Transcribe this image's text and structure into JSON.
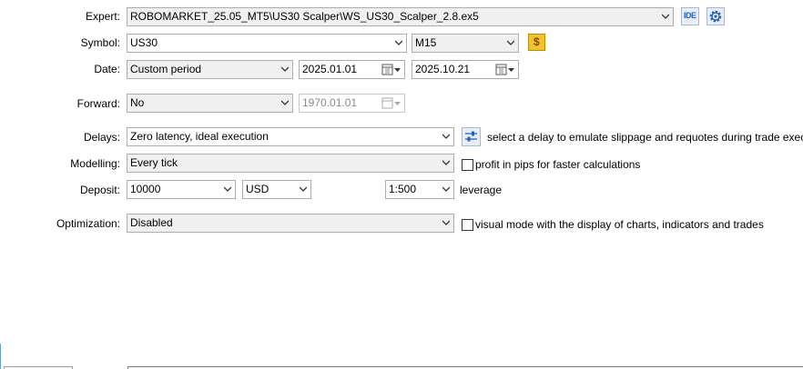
{
  "expert": {
    "label": "Expert:",
    "value": "ROBOMARKET_25.05_MT5\\US30 Scalper\\WS_US30_Scalper_2.8.ex5",
    "ide_label": "IDE"
  },
  "symbol": {
    "label": "Symbol:",
    "value": "US30",
    "timeframe": "M15"
  },
  "date": {
    "label": "Date:",
    "period": "Custom period",
    "from": "2025.01.01",
    "to": "2025.10.21"
  },
  "forward": {
    "label": "Forward:",
    "value": "No",
    "date": "1970.01.01"
  },
  "delays": {
    "label": "Delays:",
    "value": "Zero latency, ideal execution",
    "hint": "select a delay to emulate slippage and requotes during trade execution"
  },
  "modelling": {
    "label": "Modelling:",
    "value": "Every tick",
    "checkbox_label": "profit in pips for faster calculations",
    "checked": false
  },
  "deposit": {
    "label": "Deposit:",
    "amount": "10000",
    "currency": "USD",
    "leverage": "1:500",
    "leverage_label": "leverage"
  },
  "optimization": {
    "label": "Optimization:",
    "value": "Disabled",
    "visual_label": "visual mode with the display of charts, indicators and trades",
    "visual_checked": false
  },
  "colors": {
    "coin_icon": "#f2c230",
    "icon_blue": "#2a63b8"
  }
}
